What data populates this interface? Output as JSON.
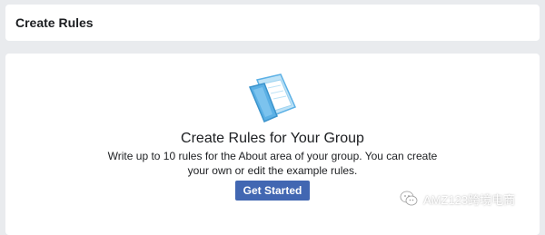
{
  "header": {
    "title": "Create Rules"
  },
  "empty_state": {
    "icon": "open-book-icon",
    "title": "Create Rules for Your Group",
    "description": "Write up to 10 rules for the About area of your group. You can create your own or edit the example rules.",
    "button_label": "Get Started"
  },
  "watermark": {
    "icon": "wechat-icon",
    "text": "AMZ123跨境电商"
  },
  "colors": {
    "page_background": "#e9ebee",
    "card_background": "#ffffff",
    "primary_button": "#4267b2",
    "illustration_blue": "#5bb0e5"
  }
}
